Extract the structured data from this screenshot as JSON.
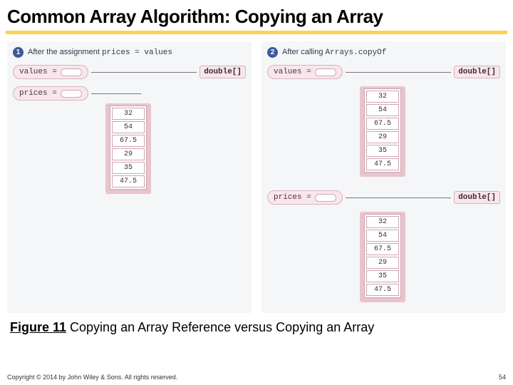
{
  "title": "Common Array Algorithm:  Copying an Array",
  "panel1": {
    "step": "1",
    "lead": "After the assignment ",
    "code": "prices = values",
    "var_values": "values =",
    "var_prices": "prices =",
    "type1": "double[]"
  },
  "panel2": {
    "step": "2",
    "lead": "After calling ",
    "code": "Arrays.copyOf",
    "var_values": "values =",
    "var_prices": "prices =",
    "type1": "double[]",
    "type2": "double[]"
  },
  "array_values": [
    "32",
    "54",
    "67.5",
    "29",
    "35",
    "47.5"
  ],
  "caption_bold": "Figure 11",
  "caption_rest": " Copying an Array Reference versus Copying an Array",
  "copyright": "Copyright © 2014 by John Wiley & Sons. All rights reserved.",
  "page": "54"
}
